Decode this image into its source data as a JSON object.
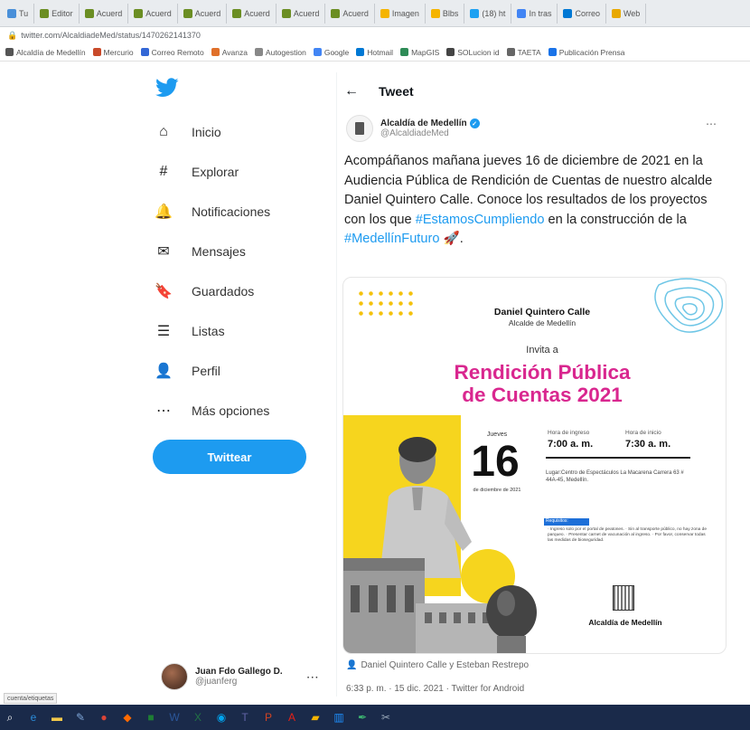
{
  "browser": {
    "tabs": [
      {
        "label": "Tu",
        "color": "#4a90d9"
      },
      {
        "label": "Editor",
        "color": "#6b8e23"
      },
      {
        "label": "Acuerd",
        "color": "#6b8e23"
      },
      {
        "label": "Acuerd",
        "color": "#6b8e23"
      },
      {
        "label": "Acuerd",
        "color": "#6b8e23"
      },
      {
        "label": "Acuerd",
        "color": "#6b8e23"
      },
      {
        "label": "Acuerd",
        "color": "#6b8e23"
      },
      {
        "label": "Acuerd",
        "color": "#6b8e23"
      },
      {
        "label": "Imagen",
        "color": "#f5b400"
      },
      {
        "label": "Blbs",
        "color": "#f5b400"
      },
      {
        "label": "(18) ht",
        "color": "#1da1f2"
      },
      {
        "label": "In tras",
        "color": "#4285f4"
      },
      {
        "label": "Correo",
        "color": "#0078d4"
      },
      {
        "label": "Web",
        "color": "#e8a800"
      }
    ],
    "url": "twitter.com/AlcaldiadeMed/status/1470262141370",
    "bookmarks": [
      {
        "label": "Alcaldía de Medellín",
        "color": "#555"
      },
      {
        "label": "Mercurio",
        "color": "#c94a2a"
      },
      {
        "label": "Correo Remoto",
        "color": "#3367d6"
      },
      {
        "label": "Avanza",
        "color": "#e0702a"
      },
      {
        "label": "Autogestion",
        "color": "#888"
      },
      {
        "label": "Google",
        "color": "#4285f4"
      },
      {
        "label": "Hotmail",
        "color": "#0078d4"
      },
      {
        "label": "MapGIS",
        "color": "#2e8b57"
      },
      {
        "label": "SOLucion id",
        "color": "#444"
      },
      {
        "label": "TAETA",
        "color": "#666"
      },
      {
        "label": "Publicación Prensa",
        "color": "#1a73e8"
      }
    ]
  },
  "sidebar": {
    "items": [
      {
        "label": "Inicio",
        "icon": "home-icon",
        "glyph": "⌂"
      },
      {
        "label": "Explorar",
        "icon": "hashtag-icon",
        "glyph": "#"
      },
      {
        "label": "Notificaciones",
        "icon": "bell-icon",
        "glyph": "🔔"
      },
      {
        "label": "Mensajes",
        "icon": "envelope-icon",
        "glyph": "✉"
      },
      {
        "label": "Guardados",
        "icon": "bookmark-icon",
        "glyph": "🔖"
      },
      {
        "label": "Listas",
        "icon": "list-icon",
        "glyph": "☰"
      },
      {
        "label": "Perfil",
        "icon": "person-icon",
        "glyph": "👤"
      },
      {
        "label": "Más opciones",
        "icon": "more-options-icon",
        "glyph": "⋯"
      }
    ],
    "tweet_button": "Twittear",
    "profile": {
      "name": "Juan Fdo Gallego D.",
      "handle": "@juanferg",
      "more": "⋯"
    }
  },
  "tweet": {
    "header_title": "Tweet",
    "author": {
      "name": "Alcaldía de Medellín",
      "handle": "@AlcaldiadeMed",
      "more": "⋯",
      "verified": "✓"
    },
    "text_plain_1": "Acompáñanos mañana jueves 16 de diciembre de 2021 en la Audiencia Pública de Rendición de Cuentas de nuestro alcalde Daniel Quintero Calle. Conoce los resultados de los proyectos con los que ",
    "hashtag_1": "#EstamosCumpliendo",
    "text_plain_2": " en la construcción de la ",
    "hashtag_2": "#MedellínFuturo",
    "emoji": " 🚀.",
    "credit": "Daniel Quintero Calle y Esteban Restrepo",
    "meta": "6:33 p. m. · 15 dic. 2021 · Twitter for Android"
  },
  "poster": {
    "name": "Daniel Quintero Calle",
    "role": "Alcalde de Medellín",
    "invita": "Invita a",
    "headline_1": "Rendición Pública",
    "headline_2": "de Cuentas 2021",
    "day_label": "Jueves",
    "day": "16",
    "month": "de diciembre de 2021",
    "time_label_1": "Hora de ingreso",
    "time_label_2": "Hora de inicio",
    "time_1": "7:00 a. m.",
    "time_2": "7:30 a. m.",
    "place": "Lugar:Centro de Espectáculos La Macarena Carrera 63 # 44A-45, Medellín.",
    "req_tag": "Requisitos:",
    "requirements": "· Ingreso solo por el portal de peatones. · Sin al transporte público, no hay zona de parqueo. · Presentar carnet de vacunación al ingreso. · Por favor, conservar todas las medidas de bioseguridad.",
    "footer": "Alcaldía de Medellín",
    "accent_pink": "#d9278f",
    "accent_yellow": "#f6d51e"
  },
  "status_tip": "cuenta/etiquetas",
  "taskbar": {
    "icons": [
      {
        "name": "search-icon",
        "glyph": "⌕",
        "color": "#ffffff"
      },
      {
        "name": "edge-icon",
        "glyph": "e",
        "color": "#2b8cd9"
      },
      {
        "name": "explorer-icon",
        "glyph": "▬",
        "color": "#f3c84a"
      },
      {
        "name": "pen-icon",
        "glyph": "✎",
        "color": "#7fa7d9"
      },
      {
        "name": "chrome-icon",
        "glyph": "●",
        "color": "#db4437"
      },
      {
        "name": "photos-icon",
        "glyph": "◆",
        "color": "#ff6a00"
      },
      {
        "name": "sheet-icon",
        "glyph": "■",
        "color": "#1e7e34"
      },
      {
        "name": "word-icon",
        "glyph": "W",
        "color": "#2b579a"
      },
      {
        "name": "excel-icon",
        "glyph": "X",
        "color": "#217346"
      },
      {
        "name": "map-icon",
        "glyph": "◉",
        "color": "#00a4ef"
      },
      {
        "name": "teams-icon",
        "glyph": "T",
        "color": "#6264a7"
      },
      {
        "name": "ppt-icon",
        "glyph": "P",
        "color": "#d04423"
      },
      {
        "name": "acrobat-icon",
        "glyph": "A",
        "color": "#e62117"
      },
      {
        "name": "folder-icon",
        "glyph": "▰",
        "color": "#f5b400"
      },
      {
        "name": "chart-icon",
        "glyph": "▥",
        "color": "#1e90ff"
      },
      {
        "name": "pen2-icon",
        "glyph": "✒",
        "color": "#3cb371"
      },
      {
        "name": "snip-icon",
        "glyph": "✂",
        "color": "#9aa9ba"
      }
    ]
  }
}
